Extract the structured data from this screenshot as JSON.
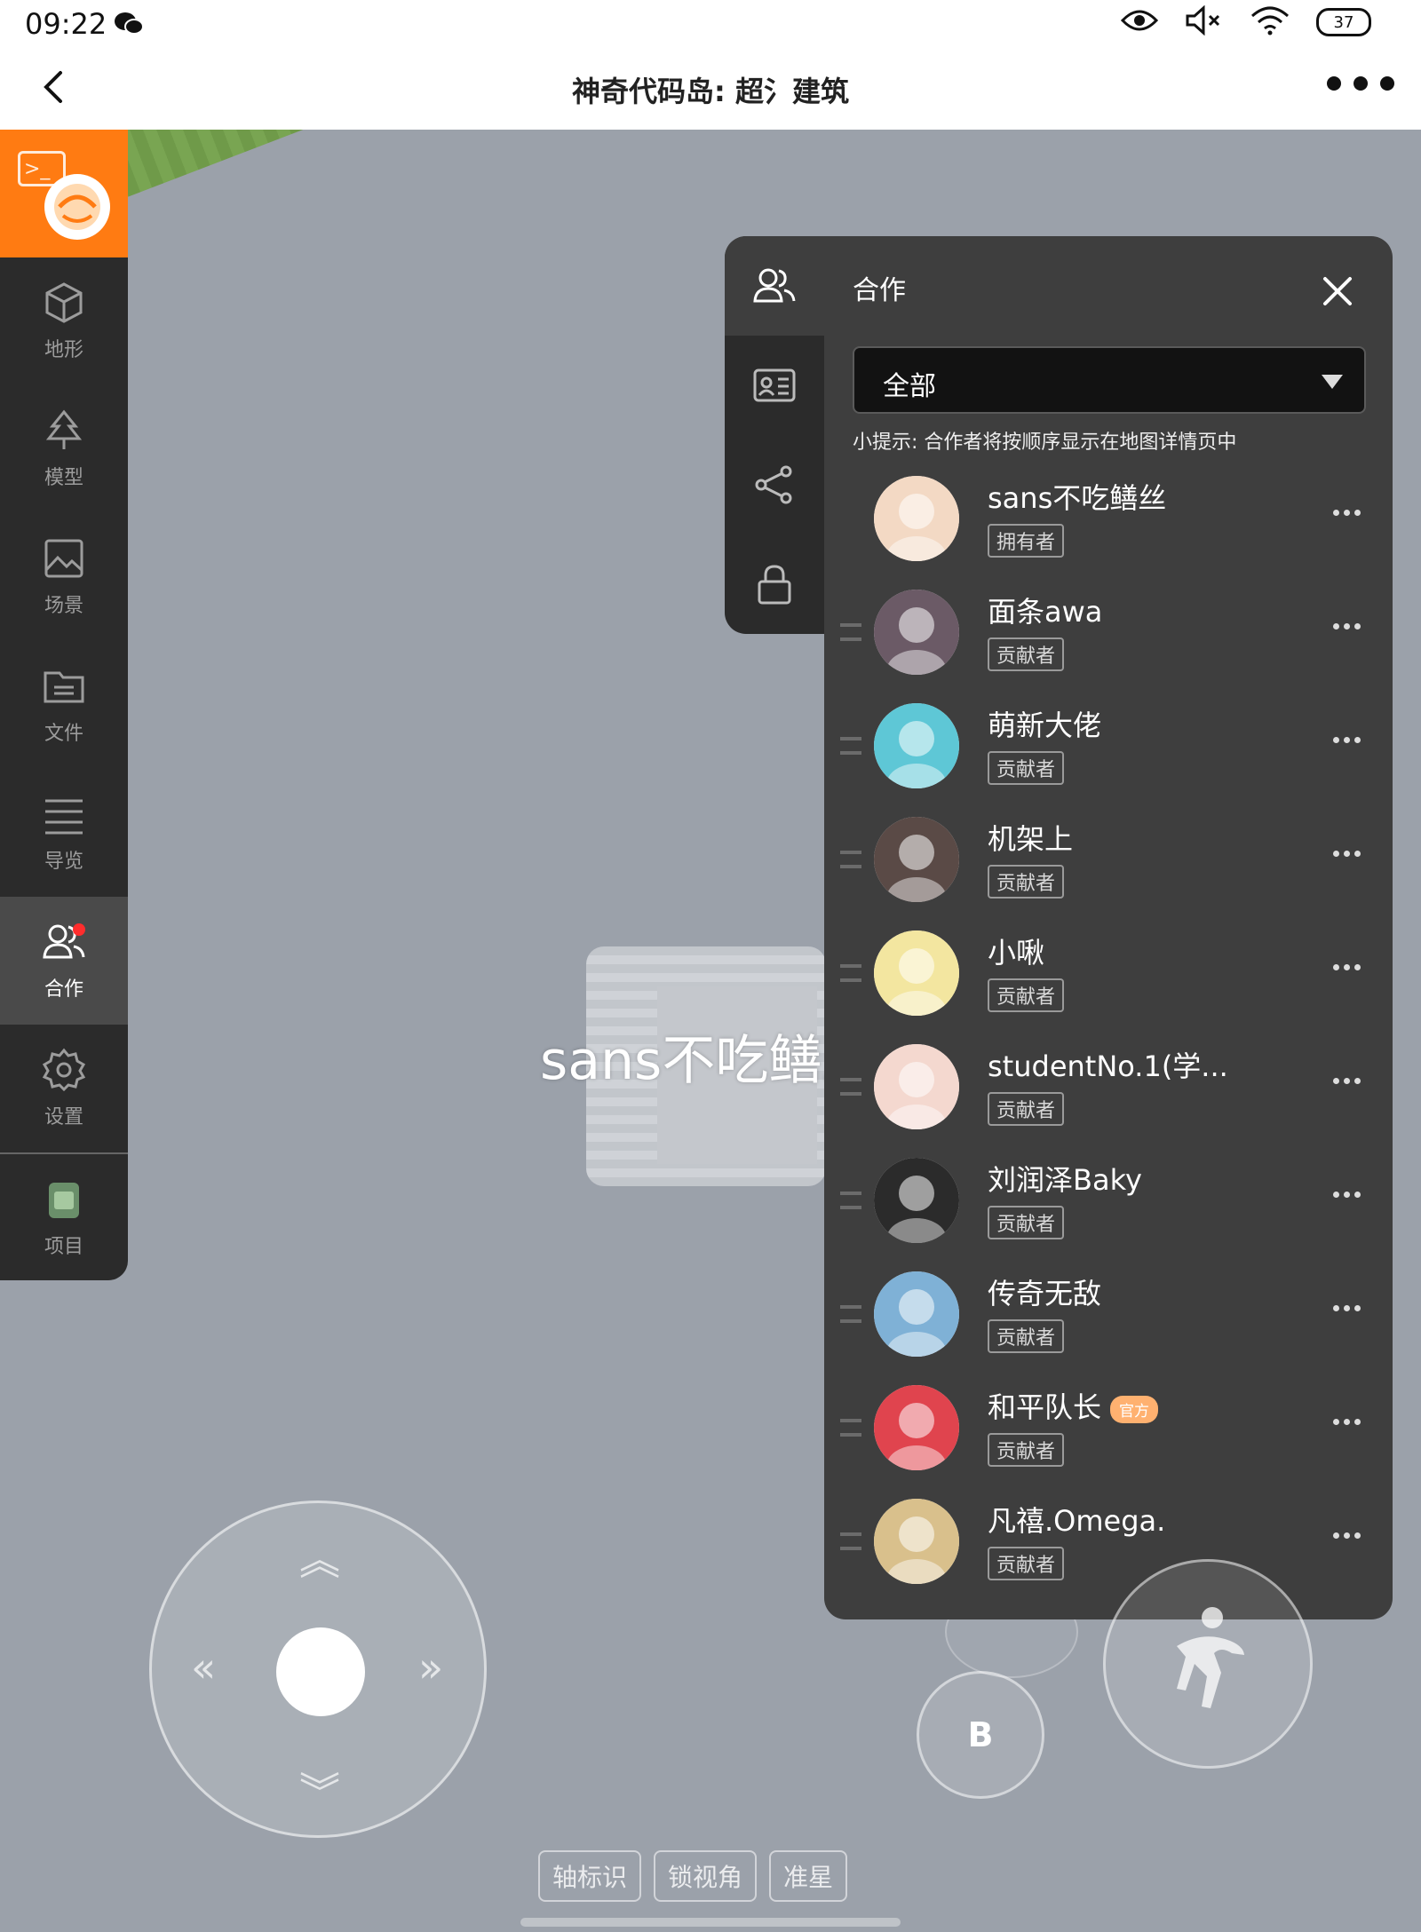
{
  "status_bar": {
    "time": "09:22",
    "battery": "37"
  },
  "title_bar": {
    "title": "神奇代码岛: 超氵建筑"
  },
  "sidebar": {
    "items": [
      {
        "label": "地形",
        "icon": "cube-icon"
      },
      {
        "label": "模型",
        "icon": "tree-icon"
      },
      {
        "label": "场景",
        "icon": "image-icon"
      },
      {
        "label": "文件",
        "icon": "folder-icon"
      },
      {
        "label": "导览",
        "icon": "list-icon"
      },
      {
        "label": "合作",
        "icon": "users-icon"
      },
      {
        "label": "设置",
        "icon": "gear-icon"
      },
      {
        "label": "项目",
        "icon": "project-icon"
      }
    ]
  },
  "scene": {
    "player_name": "sans不吃鳝丝"
  },
  "panel": {
    "title": "合作",
    "filter_value": "全部",
    "tip": "小提示: 合作者将按顺序显示在地图详情页中",
    "members": [
      {
        "name": "sans不吃鳝丝",
        "role": "拥有者",
        "color": "#f3d9c4"
      },
      {
        "name": "面条awa",
        "role": "贡献者",
        "color": "#6b5a66"
      },
      {
        "name": "萌新大佬",
        "role": "贡献者",
        "color": "#5ec7d6"
      },
      {
        "name": "机架上",
        "role": "贡献者",
        "color": "#5a4a46"
      },
      {
        "name": "小啾",
        "role": "贡献者",
        "color": "#f3e6a0"
      },
      {
        "name": "studentNo.1(学...",
        "role": "贡献者",
        "color": "#f4d8cf"
      },
      {
        "name": "刘润泽Baky",
        "role": "贡献者",
        "color": "#2b2b2b"
      },
      {
        "name": "传奇无敌",
        "role": "贡献者",
        "color": "#7fb1d6"
      },
      {
        "name": "和平队长",
        "role": "贡献者",
        "color": "#e0444e",
        "badge": "官方"
      },
      {
        "name": "凡禧.Omega.",
        "role": "贡献者",
        "color": "#d9c08c"
      }
    ]
  },
  "controls": {
    "b_label": "B",
    "bottom_buttons": [
      "轴标识",
      "锁视角",
      "准星"
    ]
  }
}
